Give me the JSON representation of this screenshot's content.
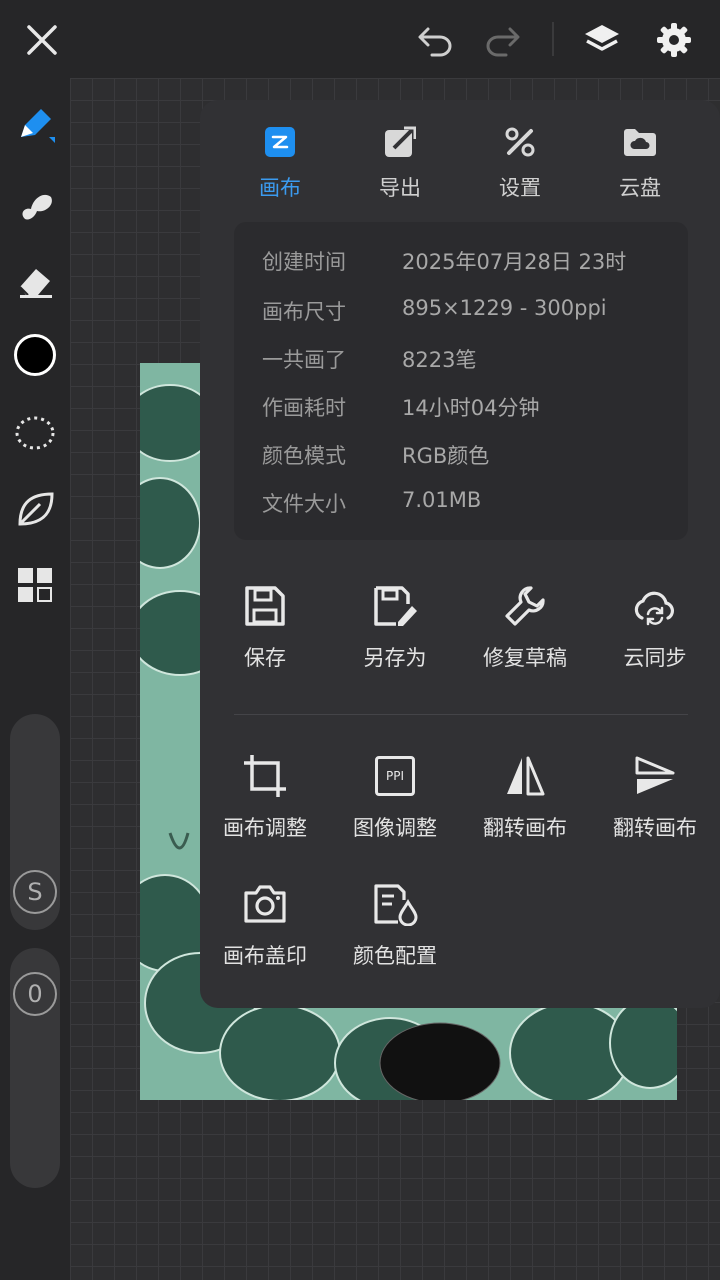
{
  "topbar": {
    "close_icon": "close-icon",
    "undo_icon": "undo-icon",
    "redo_icon": "redo-icon",
    "layers_icon": "layers-icon",
    "settings_icon": "gear-icon"
  },
  "sidebar": {
    "tools": [
      "brush",
      "smudge",
      "eraser",
      "color",
      "lasso",
      "leaf",
      "grid"
    ],
    "size_slider_label": "S",
    "opacity_slider_label": "0",
    "active_color": "#000000"
  },
  "tabs": [
    {
      "label": "画布",
      "active": true
    },
    {
      "label": "导出",
      "active": false
    },
    {
      "label": "设置",
      "active": false
    },
    {
      "label": "云盘",
      "active": false
    }
  ],
  "info": [
    {
      "key": "创建时间",
      "value": "2025年07月28日 23时"
    },
    {
      "key": "画布尺寸",
      "value": "895×1229 - 300ppi"
    },
    {
      "key": "一共画了",
      "value": "8223笔"
    },
    {
      "key": "作画耗时",
      "value": "14小时04分钟"
    },
    {
      "key": "颜色模式",
      "value": "RGB颜色"
    },
    {
      "key": "文件大小",
      "value": "7.01MB"
    }
  ],
  "actions_row1": [
    {
      "label": "保存"
    },
    {
      "label": "另存为"
    },
    {
      "label": "修复草稿"
    },
    {
      "label": "云同步"
    }
  ],
  "actions_row2": [
    {
      "label": "画布调整"
    },
    {
      "label": "图像调整",
      "icon_text": "PPI"
    },
    {
      "label": "翻转画布"
    },
    {
      "label": "翻转画布"
    }
  ],
  "actions_row3": [
    {
      "label": "画布盖印"
    },
    {
      "label": "颜色配置"
    }
  ],
  "colors": {
    "accent": "#3b9bf0",
    "panel": "#313134",
    "artwork": "#8fbfae"
  }
}
